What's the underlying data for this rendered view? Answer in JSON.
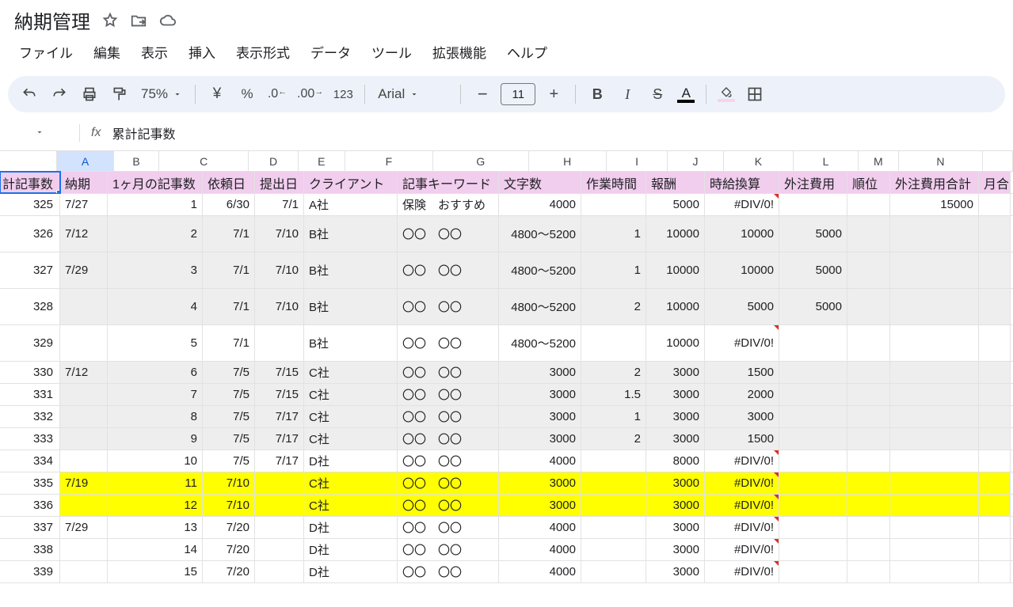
{
  "doc": {
    "title": "納期管理"
  },
  "menus": [
    "ファイル",
    "編集",
    "表示",
    "挿入",
    "表示形式",
    "データ",
    "ツール",
    "拡張機能",
    "ヘルプ"
  ],
  "toolbar": {
    "zoom": "75%",
    "font": "Arial",
    "fontSize": "11"
  },
  "namebox": {
    "value": "累計記事数"
  },
  "columns": [
    "A",
    "B",
    "C",
    "D",
    "E",
    "F",
    "G",
    "H",
    "I",
    "J",
    "K",
    "L",
    "M",
    "N",
    ""
  ],
  "selectedCol": "A",
  "headers": [
    "計記事数",
    "納期",
    "1ヶ月の記事数",
    "依頼日",
    "提出日",
    "クライアント",
    "記事キーワード",
    "文字数",
    "作業時間",
    "報酬",
    "時給換算",
    "外注費用",
    "順位",
    "外注費用合計",
    "月合"
  ],
  "rows": [
    {
      "bg": "",
      "h": "med",
      "cells": [
        "325",
        "7/27",
        "1",
        "6/30",
        "7/1",
        "A社",
        "保険　おすすめ",
        "4000",
        "",
        "5000",
        "#DIV/0!",
        "",
        "",
        "15000",
        ""
      ],
      "err": [
        10
      ]
    },
    {
      "bg": "gray",
      "h": "tall",
      "cells": [
        "326",
        "7/12",
        "2",
        "7/1",
        "7/10",
        "B社",
        "〇〇　〇〇",
        "4800～5200",
        "1",
        "10000",
        "10000",
        "5000",
        "",
        "",
        ""
      ]
    },
    {
      "bg": "gray",
      "h": "tall",
      "cells": [
        "327",
        "7/29",
        "3",
        "7/1",
        "7/10",
        "B社",
        "〇〇　〇〇",
        "4800～5200",
        "1",
        "10000",
        "10000",
        "5000",
        "",
        "",
        ""
      ]
    },
    {
      "bg": "gray",
      "h": "tall",
      "cells": [
        "328",
        "",
        "4",
        "7/1",
        "7/10",
        "B社",
        "〇〇　〇〇",
        "4800～5200",
        "2",
        "10000",
        "5000",
        "5000",
        "",
        "",
        ""
      ]
    },
    {
      "bg": "",
      "h": "tall",
      "cells": [
        "329",
        "",
        "5",
        "7/1",
        "",
        "B社",
        "〇〇　〇〇",
        "4800～5200",
        "",
        "10000",
        "#DIV/0!",
        "",
        "",
        "",
        ""
      ],
      "err": [
        10
      ]
    },
    {
      "bg": "gray",
      "h": "med",
      "cells": [
        "330",
        "7/12",
        "6",
        "7/5",
        "7/15",
        "C社",
        "〇〇　〇〇",
        "3000",
        "2",
        "3000",
        "1500",
        "",
        "",
        "",
        ""
      ]
    },
    {
      "bg": "gray",
      "h": "med",
      "cells": [
        "331",
        "",
        "7",
        "7/5",
        "7/15",
        "C社",
        "〇〇　〇〇",
        "3000",
        "1.5",
        "3000",
        "2000",
        "",
        "",
        "",
        ""
      ]
    },
    {
      "bg": "gray",
      "h": "med",
      "cells": [
        "332",
        "",
        "8",
        "7/5",
        "7/17",
        "C社",
        "〇〇　〇〇",
        "3000",
        "1",
        "3000",
        "3000",
        "",
        "",
        "",
        ""
      ]
    },
    {
      "bg": "gray",
      "h": "med",
      "cells": [
        "333",
        "",
        "9",
        "7/5",
        "7/17",
        "C社",
        "〇〇　〇〇",
        "3000",
        "2",
        "3000",
        "1500",
        "",
        "",
        "",
        ""
      ]
    },
    {
      "bg": "",
      "h": "med",
      "cells": [
        "334",
        "",
        "10",
        "7/5",
        "7/17",
        "D社",
        "〇〇　〇〇",
        "4000",
        "",
        "8000",
        "#DIV/0!",
        "",
        "",
        "",
        ""
      ],
      "err": [
        10
      ]
    },
    {
      "bg": "yellow",
      "h": "med",
      "cells": [
        "335",
        "7/19",
        "11",
        "7/10",
        "",
        "C社",
        "〇〇　〇〇",
        "3000",
        "",
        "3000",
        "#DIV/0!",
        "",
        "",
        "",
        ""
      ],
      "err": [
        10
      ]
    },
    {
      "bg": "yellow",
      "h": "med",
      "cells": [
        "336",
        "",
        "12",
        "7/10",
        "",
        "C社",
        "〇〇　〇〇",
        "3000",
        "",
        "3000",
        "#DIV/0!",
        "",
        "",
        "",
        ""
      ],
      "err": [
        10
      ]
    },
    {
      "bg": "",
      "h": "med",
      "cells": [
        "337",
        "7/29",
        "13",
        "7/20",
        "",
        "D社",
        "〇〇　〇〇",
        "4000",
        "",
        "3000",
        "#DIV/0!",
        "",
        "",
        "",
        ""
      ],
      "err": [
        10
      ]
    },
    {
      "bg": "",
      "h": "med",
      "cells": [
        "338",
        "",
        "14",
        "7/20",
        "",
        "D社",
        "〇〇　〇〇",
        "4000",
        "",
        "3000",
        "#DIV/0!",
        "",
        "",
        "",
        ""
      ],
      "err": [
        10
      ]
    },
    {
      "bg": "",
      "h": "med",
      "cells": [
        "339",
        "",
        "15",
        "7/20",
        "",
        "D社",
        "〇〇　〇〇",
        "4000",
        "",
        "3000",
        "#DIV/0!",
        "",
        "",
        "",
        ""
      ],
      "err": [
        10
      ]
    }
  ],
  "colClasses": [
    "cA",
    "cB",
    "cC",
    "cD",
    "cE",
    "cF",
    "cG",
    "cH",
    "cI",
    "cJ",
    "cK",
    "cL",
    "cM",
    "cN",
    "cO"
  ],
  "align": [
    "ar",
    "al",
    "ar",
    "ar",
    "ar",
    "al",
    "al",
    "ar",
    "ar",
    "ar",
    "ar",
    "ar",
    "ar",
    "ar",
    "al"
  ]
}
